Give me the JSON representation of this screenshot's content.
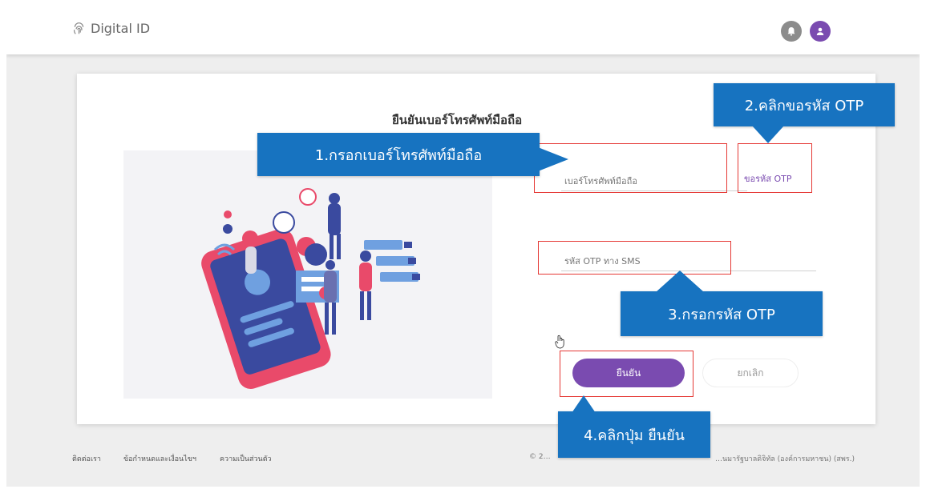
{
  "header": {
    "app_title": "Digital ID",
    "icons": [
      "fingerprint-icon",
      "bell-icon",
      "user-icon"
    ]
  },
  "form": {
    "title": "ยืนยันเบอร์โทรศัพท์มือถือ",
    "phone_placeholder": "เบอร์โทรศัพท์มือถือ",
    "request_otp_label": "ขอรหัส OTP",
    "otp_placeholder": "รหัส OTP ทาง SMS",
    "confirm_label": "ยืนยัน",
    "cancel_label": "ยกเลิก"
  },
  "annotations": {
    "step1": "1.กรอกเบอร์โทรศัพท์มือถือ",
    "step2": "2.คลิกขอรหัส OTP",
    "step3": "3.กรอกรหัส OTP",
    "step4": "4.คลิกปุ่ม ยืนยัน"
  },
  "footer": {
    "contact": "ติดต่อเรา",
    "terms": "ข้อกำหนดและเงื่อนไขฯ",
    "privacy": "ความเป็นส่วนตัว",
    "copyright": "© 2…",
    "agency": "…นมารัฐบาลดิจิทัล (องค์การมหาชน) (สพร.)"
  },
  "colors": {
    "primary": "#7a4bb0",
    "callout": "#1773c0",
    "highlight": "#e53935"
  }
}
